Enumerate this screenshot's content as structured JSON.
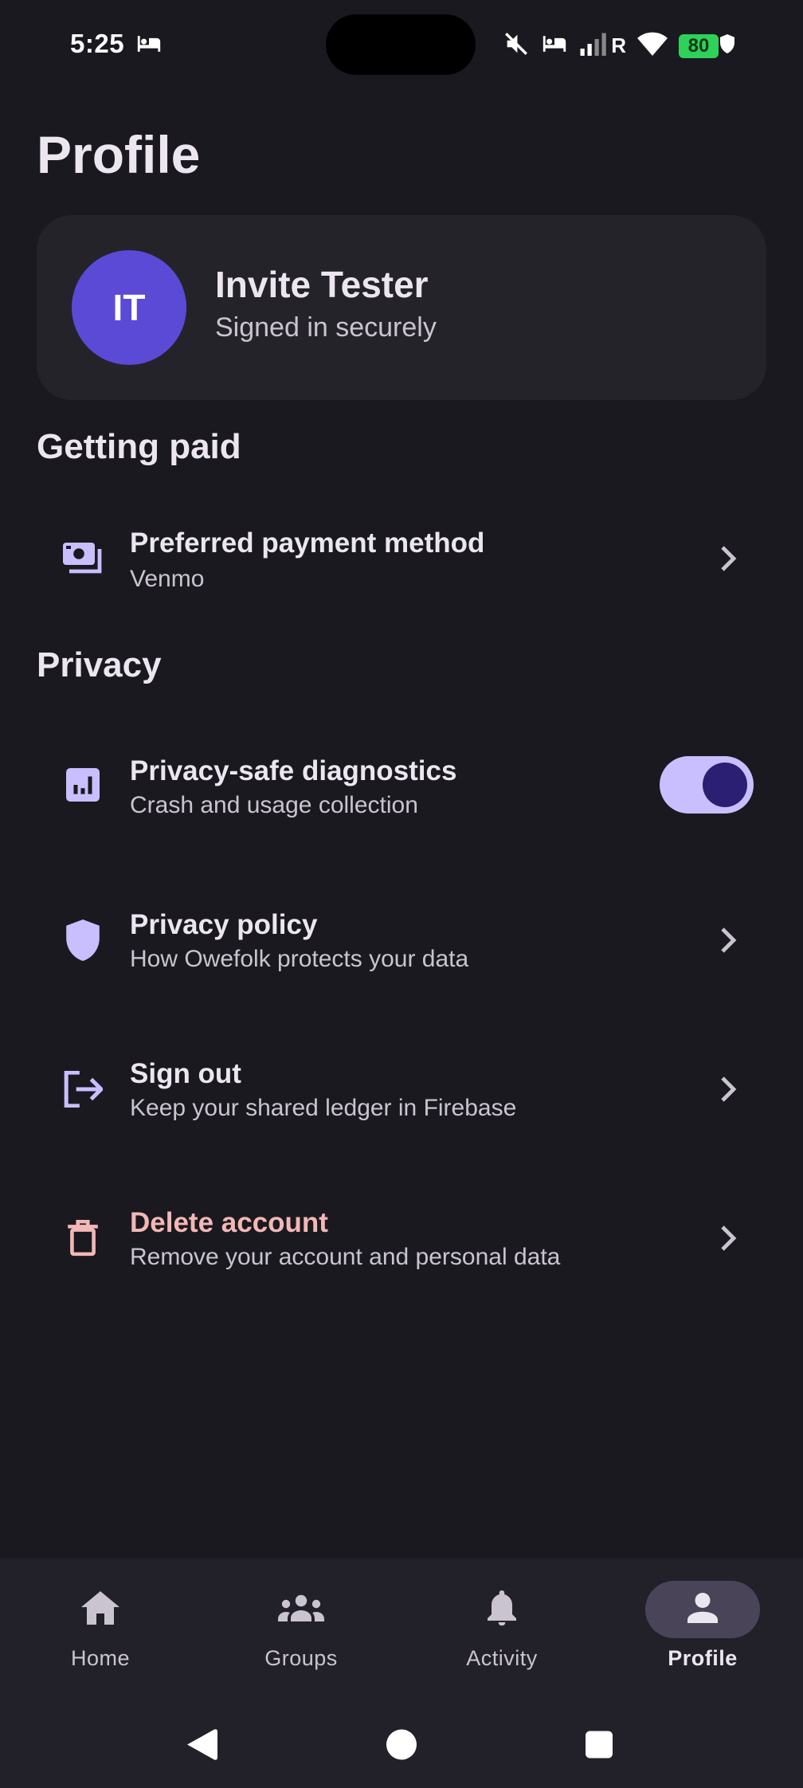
{
  "status_bar": {
    "time": "5:25",
    "battery": "80",
    "network_label": "R"
  },
  "page": {
    "title": "Profile"
  },
  "profile": {
    "initials": "IT",
    "name": "Invite Tester",
    "status": "Signed in securely"
  },
  "sections": {
    "getting_paid": "Getting paid",
    "privacy": "Privacy"
  },
  "items": {
    "payment": {
      "title": "Preferred payment method",
      "subtitle": "Venmo",
      "icon": "payments-icon"
    },
    "diagnostics": {
      "title": "Privacy-safe diagnostics",
      "subtitle": "Crash and usage collection",
      "icon": "analytics-icon",
      "enabled": true
    },
    "policy": {
      "title": "Privacy policy",
      "subtitle": "How Owefolk protects your data",
      "icon": "shield-icon"
    },
    "sign_out": {
      "title": "Sign out",
      "subtitle": "Keep your shared ledger in Firebase",
      "icon": "logout-icon"
    },
    "delete": {
      "title": "Delete account",
      "subtitle": "Remove your account and personal data",
      "icon": "trash-icon"
    }
  },
  "bottom_nav": {
    "home": "Home",
    "groups": "Groups",
    "activity": "Activity",
    "profile": "Profile",
    "active": "profile"
  },
  "colors": {
    "background": "#1a1920",
    "card": "#24232a",
    "accent": "#c9bfff",
    "avatar": "#5b4ad6",
    "danger": "#f2b8b5"
  }
}
